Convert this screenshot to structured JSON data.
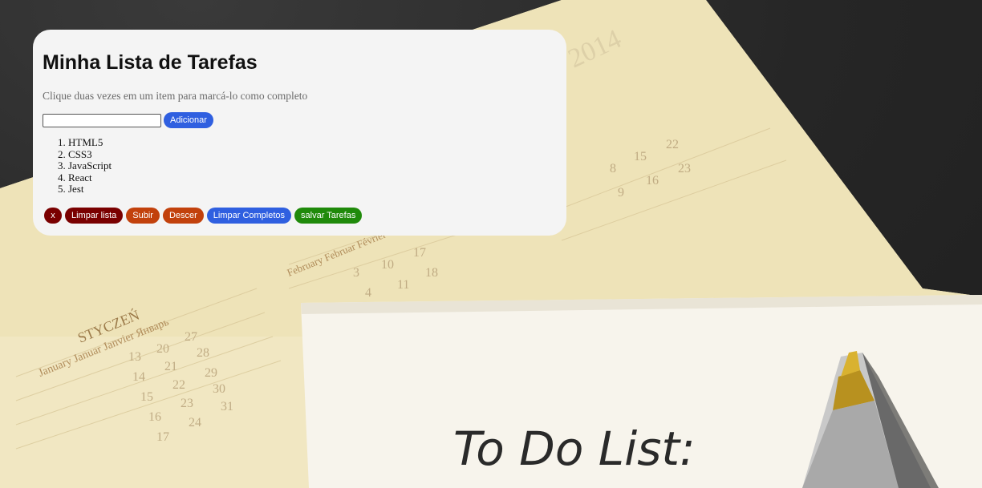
{
  "app": {
    "title": "Minha Lista de Tarefas",
    "instructions": "Clique duas vezes em um item para marcá-lo como completo"
  },
  "form": {
    "input_value": "",
    "input_placeholder": "",
    "add_label": "Adicionar"
  },
  "tasks": [
    "HTML5",
    "CSS3",
    "JavaScript",
    "React",
    "Jest"
  ],
  "actions": {
    "remove_label": "x",
    "clear_list_label": "Limpar lista",
    "move_up_label": "Subir",
    "move_down_label": "Descer",
    "clear_completed_label": "Limpar Completos",
    "save_label": "salvar Tarefas"
  },
  "background": {
    "calendar_year": "2014",
    "month_left": "STYCZEŃ",
    "month_left_langs": "January Januar Janvier Январь",
    "month_mid": "February Februar Février",
    "note_text": "To Do List:"
  },
  "colors": {
    "card_bg": "#f4f4f4",
    "blue_button": "#2f5fe0",
    "red_button": "#7a0000",
    "orange_button": "#c2410c",
    "green_button": "#1f8a0a"
  }
}
